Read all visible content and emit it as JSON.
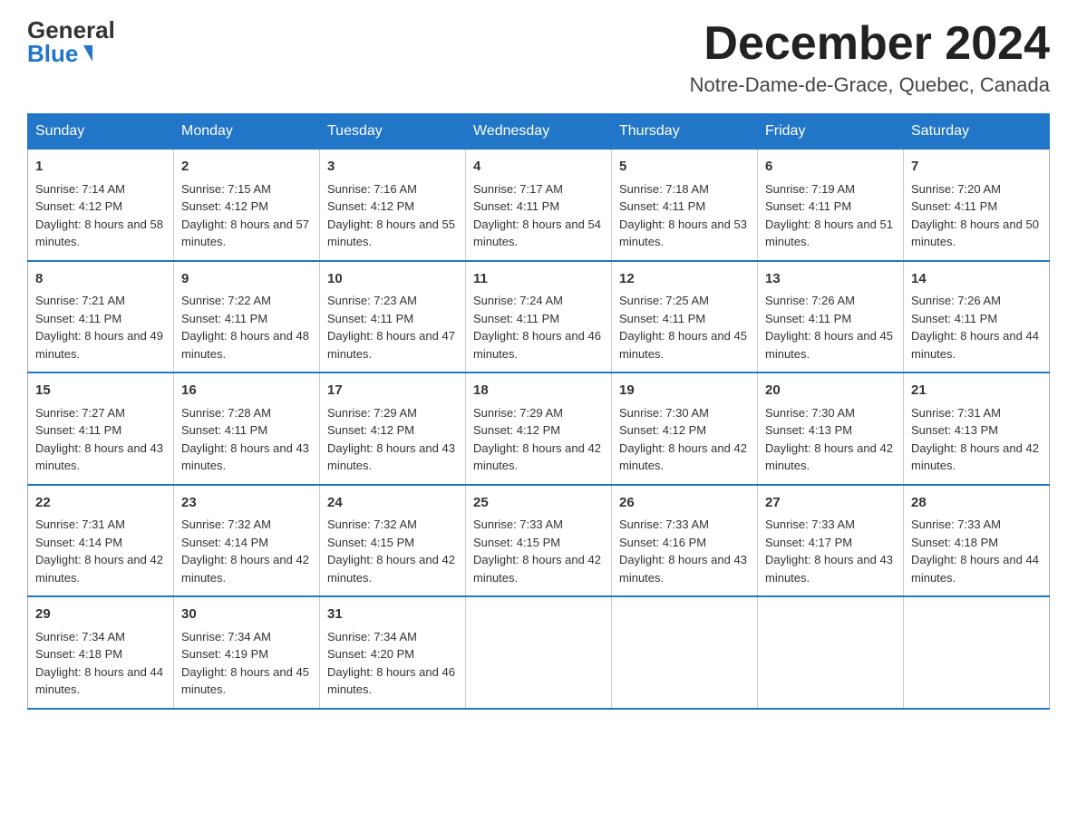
{
  "header": {
    "logo_general": "General",
    "logo_blue": "Blue",
    "month_title": "December 2024",
    "location": "Notre-Dame-de-Grace, Quebec, Canada"
  },
  "days_of_week": [
    "Sunday",
    "Monday",
    "Tuesday",
    "Wednesday",
    "Thursday",
    "Friday",
    "Saturday"
  ],
  "weeks": [
    [
      {
        "day": "1",
        "sunrise": "7:14 AM",
        "sunset": "4:12 PM",
        "daylight": "8 hours and 58 minutes."
      },
      {
        "day": "2",
        "sunrise": "7:15 AM",
        "sunset": "4:12 PM",
        "daylight": "8 hours and 57 minutes."
      },
      {
        "day": "3",
        "sunrise": "7:16 AM",
        "sunset": "4:12 PM",
        "daylight": "8 hours and 55 minutes."
      },
      {
        "day": "4",
        "sunrise": "7:17 AM",
        "sunset": "4:11 PM",
        "daylight": "8 hours and 54 minutes."
      },
      {
        "day": "5",
        "sunrise": "7:18 AM",
        "sunset": "4:11 PM",
        "daylight": "8 hours and 53 minutes."
      },
      {
        "day": "6",
        "sunrise": "7:19 AM",
        "sunset": "4:11 PM",
        "daylight": "8 hours and 51 minutes."
      },
      {
        "day": "7",
        "sunrise": "7:20 AM",
        "sunset": "4:11 PM",
        "daylight": "8 hours and 50 minutes."
      }
    ],
    [
      {
        "day": "8",
        "sunrise": "7:21 AM",
        "sunset": "4:11 PM",
        "daylight": "8 hours and 49 minutes."
      },
      {
        "day": "9",
        "sunrise": "7:22 AM",
        "sunset": "4:11 PM",
        "daylight": "8 hours and 48 minutes."
      },
      {
        "day": "10",
        "sunrise": "7:23 AM",
        "sunset": "4:11 PM",
        "daylight": "8 hours and 47 minutes."
      },
      {
        "day": "11",
        "sunrise": "7:24 AM",
        "sunset": "4:11 PM",
        "daylight": "8 hours and 46 minutes."
      },
      {
        "day": "12",
        "sunrise": "7:25 AM",
        "sunset": "4:11 PM",
        "daylight": "8 hours and 45 minutes."
      },
      {
        "day": "13",
        "sunrise": "7:26 AM",
        "sunset": "4:11 PM",
        "daylight": "8 hours and 45 minutes."
      },
      {
        "day": "14",
        "sunrise": "7:26 AM",
        "sunset": "4:11 PM",
        "daylight": "8 hours and 44 minutes."
      }
    ],
    [
      {
        "day": "15",
        "sunrise": "7:27 AM",
        "sunset": "4:11 PM",
        "daylight": "8 hours and 43 minutes."
      },
      {
        "day": "16",
        "sunrise": "7:28 AM",
        "sunset": "4:11 PM",
        "daylight": "8 hours and 43 minutes."
      },
      {
        "day": "17",
        "sunrise": "7:29 AM",
        "sunset": "4:12 PM",
        "daylight": "8 hours and 43 minutes."
      },
      {
        "day": "18",
        "sunrise": "7:29 AM",
        "sunset": "4:12 PM",
        "daylight": "8 hours and 42 minutes."
      },
      {
        "day": "19",
        "sunrise": "7:30 AM",
        "sunset": "4:12 PM",
        "daylight": "8 hours and 42 minutes."
      },
      {
        "day": "20",
        "sunrise": "7:30 AM",
        "sunset": "4:13 PM",
        "daylight": "8 hours and 42 minutes."
      },
      {
        "day": "21",
        "sunrise": "7:31 AM",
        "sunset": "4:13 PM",
        "daylight": "8 hours and 42 minutes."
      }
    ],
    [
      {
        "day": "22",
        "sunrise": "7:31 AM",
        "sunset": "4:14 PM",
        "daylight": "8 hours and 42 minutes."
      },
      {
        "day": "23",
        "sunrise": "7:32 AM",
        "sunset": "4:14 PM",
        "daylight": "8 hours and 42 minutes."
      },
      {
        "day": "24",
        "sunrise": "7:32 AM",
        "sunset": "4:15 PM",
        "daylight": "8 hours and 42 minutes."
      },
      {
        "day": "25",
        "sunrise": "7:33 AM",
        "sunset": "4:15 PM",
        "daylight": "8 hours and 42 minutes."
      },
      {
        "day": "26",
        "sunrise": "7:33 AM",
        "sunset": "4:16 PM",
        "daylight": "8 hours and 43 minutes."
      },
      {
        "day": "27",
        "sunrise": "7:33 AM",
        "sunset": "4:17 PM",
        "daylight": "8 hours and 43 minutes."
      },
      {
        "day": "28",
        "sunrise": "7:33 AM",
        "sunset": "4:18 PM",
        "daylight": "8 hours and 44 minutes."
      }
    ],
    [
      {
        "day": "29",
        "sunrise": "7:34 AM",
        "sunset": "4:18 PM",
        "daylight": "8 hours and 44 minutes."
      },
      {
        "day": "30",
        "sunrise": "7:34 AM",
        "sunset": "4:19 PM",
        "daylight": "8 hours and 45 minutes."
      },
      {
        "day": "31",
        "sunrise": "7:34 AM",
        "sunset": "4:20 PM",
        "daylight": "8 hours and 46 minutes."
      },
      null,
      null,
      null,
      null
    ]
  ]
}
